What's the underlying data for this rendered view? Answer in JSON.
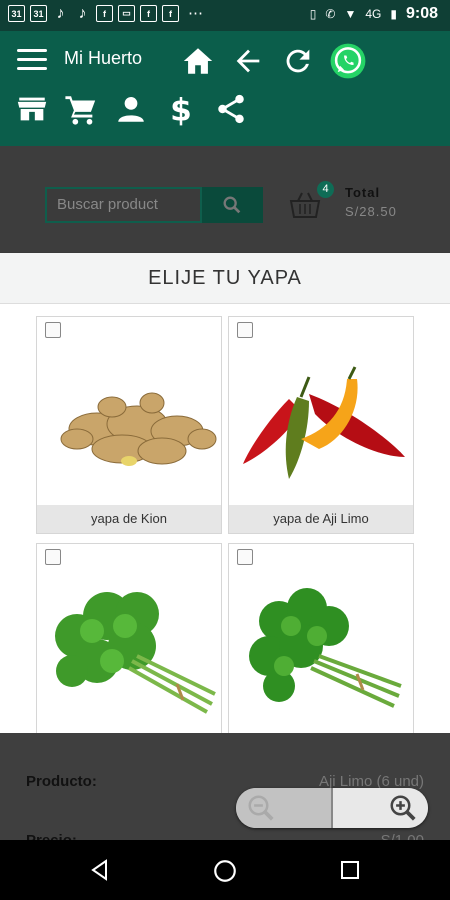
{
  "status_bar": {
    "left_icons": [
      "calendar-31-icon",
      "calendar-31-icon",
      "tiktok-icon",
      "tiktok-icon",
      "facebook-icon",
      "messaging-icon",
      "facebook-icon",
      "facebook-icon"
    ],
    "calendar_day": "31",
    "more": "⋯",
    "network": "4G",
    "time": "9:08"
  },
  "app_bar": {
    "title": "Mi Huerto",
    "icons": [
      "menu-icon",
      "home-icon",
      "back-arrow-icon",
      "refresh-icon",
      "whatsapp-icon",
      "store-icon",
      "cart-icon",
      "user-icon",
      "dollar-icon",
      "share-icon"
    ]
  },
  "search": {
    "placeholder": "Buscar product"
  },
  "cart_summary": {
    "count": "4",
    "total_label": "Total",
    "total_value": "S/28.50"
  },
  "modal": {
    "title": "ELIJE TU YAPA",
    "items": [
      {
        "label": "yapa de Kion",
        "image": "ginger"
      },
      {
        "label": "yapa de Aji Limo",
        "image": "chili-peppers"
      },
      {
        "label": "",
        "image": "parsley"
      },
      {
        "label": "",
        "image": "cilantro"
      }
    ]
  },
  "details": {
    "product_label": "Producto:",
    "product_value": "Aji Limo (6 und)",
    "price_label": "Precio:",
    "price_value": "S/1.00"
  },
  "colors": {
    "primary": "#0b5e4b",
    "status_bar": "#0f3f35",
    "whatsapp": "#25d366"
  }
}
